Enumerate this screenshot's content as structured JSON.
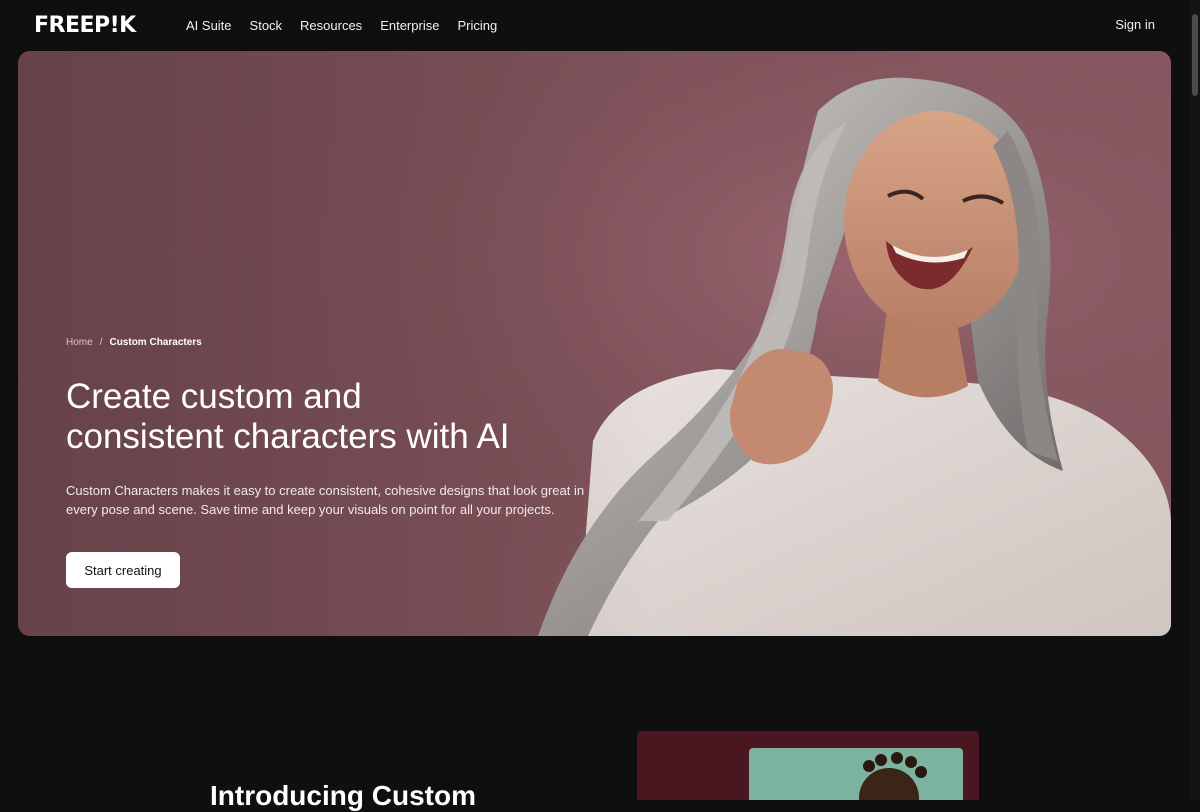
{
  "header": {
    "logo": "FREEP!K",
    "nav": [
      "AI Suite",
      "Stock",
      "Resources",
      "Enterprise",
      "Pricing"
    ],
    "sign_in": "Sign in"
  },
  "hero": {
    "breadcrumb": {
      "home": "Home",
      "separator": "/",
      "current": "Custom Characters"
    },
    "title_line1": "Create custom and",
    "title_line2": "consistent characters with AI",
    "description": "Custom Characters makes it easy to create consistent, cohesive designs that look great in every pose and scene. Save time and keep your visuals on point for all your projects.",
    "cta": "Start creating"
  },
  "intro": {
    "title": "Introducing Custom"
  }
}
